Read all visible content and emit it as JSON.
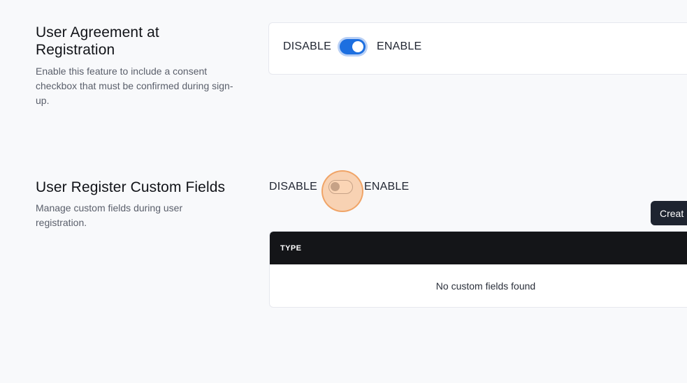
{
  "agreement": {
    "title": "User Agreement at Registration",
    "description": "Enable this feature to include a consent checkbox that must be confirmed during sign-up.",
    "disable_label": "DISABLE",
    "enable_label": "ENABLE",
    "enabled": true
  },
  "custom_fields": {
    "title": "User Register Custom Fields",
    "description": "Manage custom fields during user registration.",
    "disable_label": "DISABLE",
    "enable_label": "ENABLE",
    "enabled": false,
    "create_button": "Creat",
    "table": {
      "columns": [
        "TYPE"
      ],
      "empty_message": "No custom fields found"
    }
  },
  "colors": {
    "accent": "#1d6fe0",
    "header_dark": "#141518",
    "focus_highlight": "#f7b278"
  }
}
